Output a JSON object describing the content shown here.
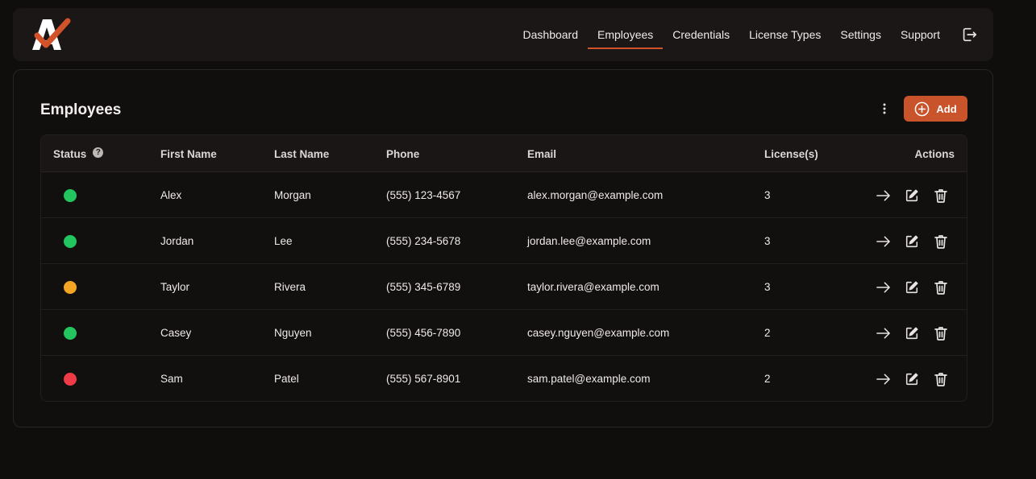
{
  "nav": {
    "items": [
      {
        "label": "Dashboard",
        "active": false
      },
      {
        "label": "Employees",
        "active": true
      },
      {
        "label": "Credentials",
        "active": false
      },
      {
        "label": "License Types",
        "active": false
      },
      {
        "label": "Settings",
        "active": false
      },
      {
        "label": "Support",
        "active": false
      }
    ],
    "logout_icon": "logout-icon"
  },
  "page": {
    "title": "Employees",
    "more_icon": "kebab-menu-icon",
    "add_label": "Add",
    "add_icon": "plus-circle-icon"
  },
  "table": {
    "headers": {
      "status": "Status",
      "first_name": "First Name",
      "last_name": "Last Name",
      "phone": "Phone",
      "email": "Email",
      "licenses": "License(s)",
      "actions": "Actions"
    },
    "help_glyph": "?",
    "rows": [
      {
        "status": "green",
        "first_name": "Alex",
        "last_name": "Morgan",
        "phone": "(555) 123-4567",
        "email": "alex.morgan@example.com",
        "licenses": "3"
      },
      {
        "status": "green",
        "first_name": "Jordan",
        "last_name": "Lee",
        "phone": "(555) 234-5678",
        "email": "jordan.lee@example.com",
        "licenses": "3"
      },
      {
        "status": "amber",
        "first_name": "Taylor",
        "last_name": "Rivera",
        "phone": "(555) 345-6789",
        "email": "taylor.rivera@example.com",
        "licenses": "3"
      },
      {
        "status": "green",
        "first_name": "Casey",
        "last_name": "Nguyen",
        "phone": "(555) 456-7890",
        "email": "casey.nguyen@example.com",
        "licenses": "2"
      },
      {
        "status": "red",
        "first_name": "Sam",
        "last_name": "Patel",
        "phone": "(555) 567-8901",
        "email": "sam.patel@example.com",
        "licenses": "2"
      }
    ]
  },
  "colors": {
    "accent": "#c9532a",
    "green": "#22c55e",
    "amber": "#f5a524",
    "red": "#ef3b45"
  }
}
